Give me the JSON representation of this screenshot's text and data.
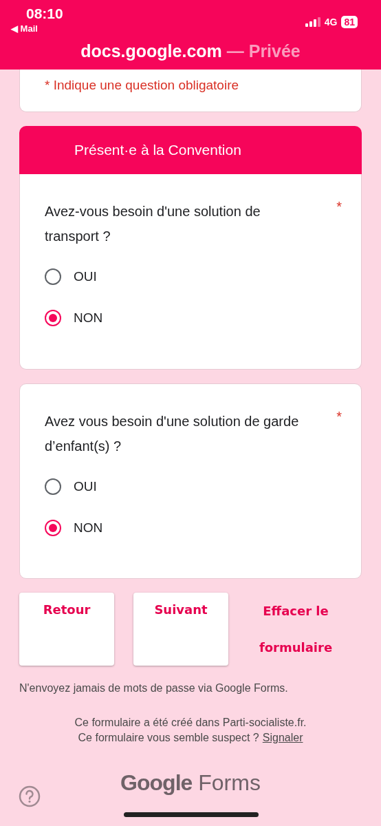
{
  "status_bar": {
    "time": "08:10",
    "back_link": "◀ Mail",
    "network": "4G",
    "battery": "81"
  },
  "address_bar": {
    "domain": "docs.google.com",
    "mode": "— Privée"
  },
  "required_note": "* Indique une question obligatoire",
  "section": {
    "title": "Présent·e à la Convention"
  },
  "questions": [
    {
      "text": "Avez-vous besoin d'une solution de transport ?",
      "required_mark": "*",
      "options": [
        {
          "label": "OUI",
          "selected": false
        },
        {
          "label": "NON",
          "selected": true
        }
      ]
    },
    {
      "text": "Avez vous besoin d'une solution de garde d’enfant(s) ?",
      "required_mark": "*",
      "options": [
        {
          "label": "OUI",
          "selected": false
        },
        {
          "label": "NON",
          "selected": true
        }
      ]
    }
  ],
  "buttons": [
    {
      "label": "Retour",
      "kind": "raised"
    },
    {
      "label": "Suivant",
      "kind": "raised"
    },
    {
      "label": "Effacer le formulaire",
      "kind": "text"
    }
  ],
  "password_notice": "N'envoyez jamais de mots de passe via Google Forms.",
  "footer": {
    "created_in": "Ce formulaire a été créé dans Parti-socialiste.fr.",
    "suspect": "Ce formulaire vous semble suspect ?",
    "report_link": "Signaler"
  },
  "logo": {
    "word1": "Google",
    "word2": "Forms"
  }
}
